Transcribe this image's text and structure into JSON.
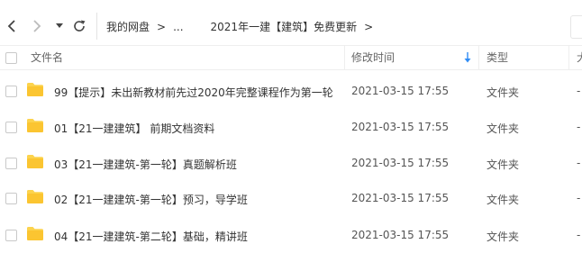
{
  "toolbar": {
    "breadcrumb": [
      "我的网盘",
      "...",
      "2021年一建【建筑】免费更新"
    ],
    "arrow": ">"
  },
  "columns": {
    "name": "文件名",
    "modified": "修改时间",
    "type": "类型",
    "size": "大"
  },
  "files": [
    {
      "name": "99【提示】未出新教材前先过2020年完整课程作为第一轮",
      "modified": "2021-03-15 17:55",
      "type": "文件夹",
      "size": "-"
    },
    {
      "name": "01【21一建建筑】 前期文档资料",
      "modified": "2021-03-15 17:55",
      "type": "文件夹",
      "size": "-"
    },
    {
      "name": "03【21一建建筑-第一轮】真题解析班",
      "modified": "2021-03-15 17:55",
      "type": "文件夹",
      "size": "-"
    },
    {
      "name": "02【21一建建筑-第一轮】预习，导学班",
      "modified": "2021-03-15 17:55",
      "type": "文件夹",
      "size": "-"
    },
    {
      "name": "04【21一建建筑-第二轮】基础，精讲班",
      "modified": "2021-03-15 17:55",
      "type": "文件夹",
      "size": "-"
    }
  ],
  "colors": {
    "folder": "#fcd34d",
    "sort_arrow": "#2f8cf5"
  }
}
